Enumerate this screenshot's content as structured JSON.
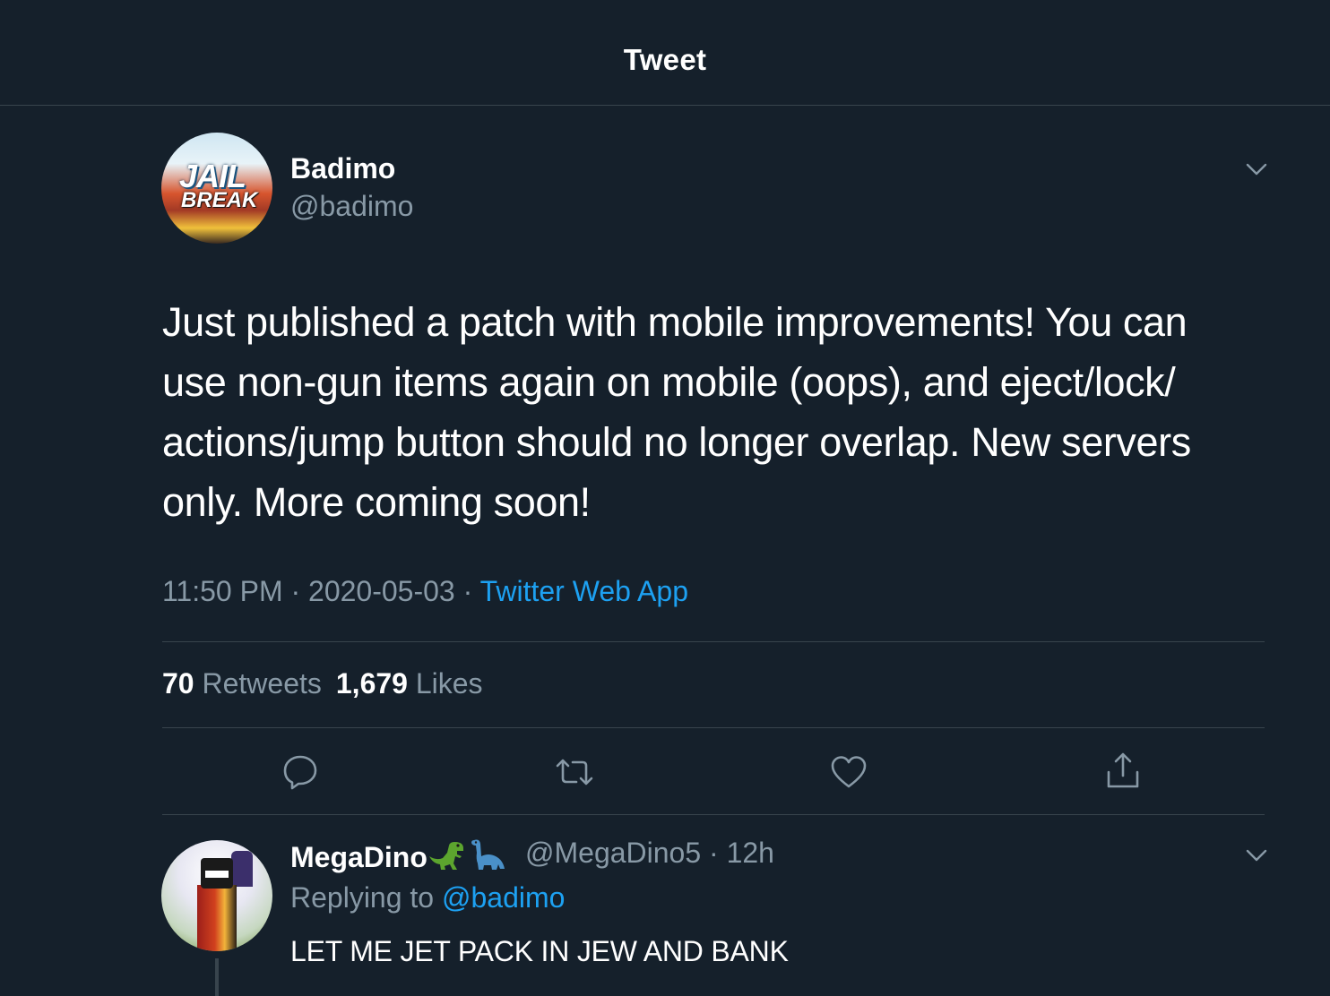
{
  "header": {
    "title": "Tweet"
  },
  "tweet": {
    "avatar_text_top": "JAIL",
    "avatar_text_bottom": "BREAK",
    "author_name": "Badimo",
    "author_handle": "@badimo",
    "text": "Just published a patch with mobile improvements! You can use non-gun items again on mobile (oops), and eject/lock/ actions/jump button should no longer overlap. New servers only. More coming soon!",
    "time": "11:50 PM",
    "date": "2020-05-03",
    "source": "Twitter Web App",
    "retweets_count": "70",
    "retweets_label": "Retweets",
    "likes_count": "1,679",
    "likes_label": "Likes"
  },
  "actions": {
    "reply_icon": "reply-icon",
    "retweet_icon": "retweet-icon",
    "like_icon": "heart-icon",
    "share_icon": "share-icon"
  },
  "reply": {
    "author_name": "MegaDino",
    "author_handle": "@MegaDino5",
    "time_ago": "12h",
    "replying_label": "Replying to",
    "replying_to": "@badimo",
    "text": "LET ME JET PACK IN JEW AND BANK"
  },
  "colors": {
    "background": "#15202b",
    "accent": "#1da1f2",
    "secondary_text": "#8899a6",
    "divider": "#38444d"
  }
}
